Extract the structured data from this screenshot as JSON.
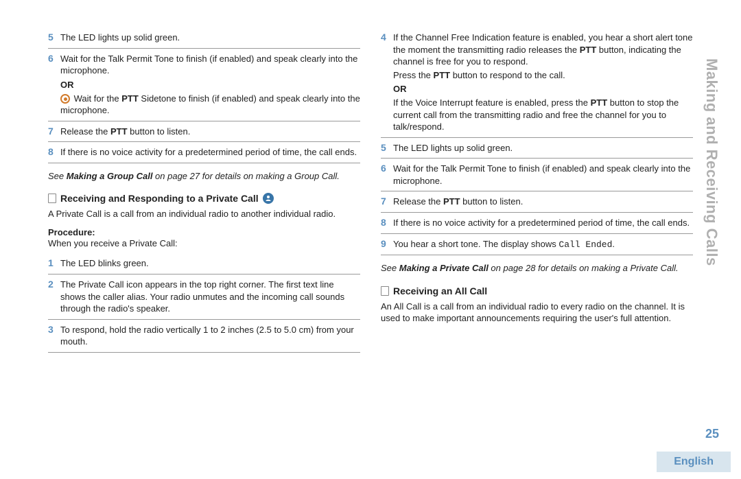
{
  "sideTitle": "Making and Receiving Calls",
  "pageNumber": "25",
  "language": "English",
  "left": {
    "steps1": {
      "s5": "The LED lights up solid green.",
      "s6a": "Wait for the Talk Permit Tone to finish (if enabled) and speak clearly into the microphone.",
      "or": "OR",
      "s6b_pre": "Wait for the ",
      "s6b_bold": "PTT",
      "s6b_post": " Sidetone to finish (if enabled) and speak clearly into the microphone.",
      "s7_pre": "Release the ",
      "s7_bold": "PTT",
      "s7_post": " button to listen.",
      "s8": "If there is no voice activity for a predetermined period of time, the call ends."
    },
    "note1_pre": "See ",
    "note1_bold": "Making a Group Call",
    "note1_post": " on page 27 for details on making a Group Call.",
    "section1": "Receiving and Responding to a Private Call",
    "intro1": "A Private Call is a call from an individual radio to another individual radio.",
    "procLabel": "Procedure:",
    "procText": "When you receive a Private Call:",
    "steps2": {
      "s1": "The LED blinks green.",
      "s2": "The Private Call icon appears in the top right corner. The first text line shows the caller alias. Your radio unmutes and the incoming call sounds through the radio's speaker.",
      "s3": "To respond, hold the radio vertically 1 to 2 inches (2.5 to 5.0 cm) from your mouth."
    }
  },
  "right": {
    "steps1": {
      "s4a_pre": "If the Channel Free Indication feature is enabled, you hear a short alert tone the moment the transmitting radio releases the ",
      "s4a_bold": "PTT",
      "s4a_post": " button, indicating the channel is free for you to respond.",
      "s4b_pre": "Press the ",
      "s4b_bold": "PTT",
      "s4b_post": " button to respond to the call.",
      "or": "OR",
      "s4c_pre": "If the Voice Interrupt feature is enabled, press the ",
      "s4c_bold": "PTT",
      "s4c_post": " button to stop the current call from the transmitting radio and free the channel for you to talk/respond.",
      "s5": "The LED lights up solid green.",
      "s6": "Wait for the Talk Permit Tone to finish (if enabled) and speak clearly into the microphone.",
      "s7_pre": "Release the ",
      "s7_bold": "PTT",
      "s7_post": " button to listen.",
      "s8": "If there is no voice activity for a predetermined period of time, the call ends.",
      "s9_pre": "You hear a short tone. The display shows ",
      "s9_mono": "Call Ended",
      "s9_post": "."
    },
    "note1_pre": "See ",
    "note1_bold": "Making a Private Call",
    "note1_post": " on page 28 for details on making a Private Call.",
    "section2": "Receiving an All Call",
    "intro2": "An All Call is a call from an individual radio to every radio on the channel. It is used to make important announcements requiring the user's full attention."
  }
}
